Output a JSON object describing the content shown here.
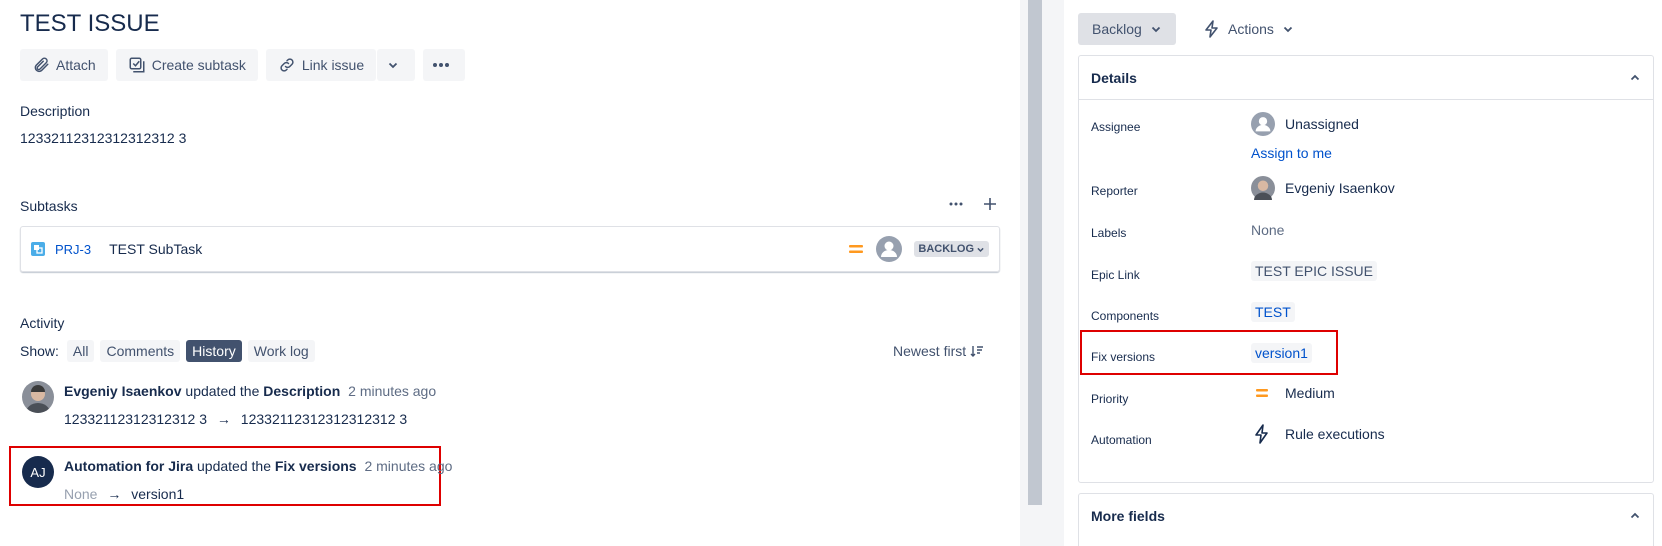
{
  "issue": {
    "title": "TEST ISSUE"
  },
  "toolbar": {
    "attach": "Attach",
    "create_subtask": "Create subtask",
    "link_issue": "Link issue"
  },
  "description": {
    "label": "Description",
    "text": "12332112312312312312 3"
  },
  "subtasks": {
    "label": "Subtasks",
    "items": [
      {
        "key": "PRJ-3",
        "summary": "TEST SubTask",
        "status": "BACKLOG"
      }
    ]
  },
  "activity": {
    "label": "Activity",
    "show_label": "Show:",
    "filters": [
      "All",
      "Comments",
      "History",
      "Work log"
    ],
    "active_filter": "History",
    "sort_label": "Newest first",
    "entries": [
      {
        "author": "Evgeniy Isaenkov",
        "verb": "updated the",
        "field": "Description",
        "time": "2 minutes ago",
        "from": "12332112312312312 3",
        "arrow": "→",
        "to": "12332112312312312312 3"
      },
      {
        "author": "Automation for Jira",
        "initials": "AJ",
        "verb": "updated the",
        "field": "Fix versions",
        "time": "2 minutes ago",
        "from": "None",
        "arrow": "→",
        "to": "version1"
      }
    ]
  },
  "sidebar": {
    "status_button": "Backlog",
    "actions_button": "Actions",
    "details": {
      "title": "Details",
      "fields": {
        "assignee_label": "Assignee",
        "assignee_value": "Unassigned",
        "assign_to_me": "Assign to me",
        "reporter_label": "Reporter",
        "reporter_value": "Evgeniy Isaenkov",
        "labels_label": "Labels",
        "labels_value": "None",
        "epic_label": "Epic Link",
        "epic_value": "TEST EPIC ISSUE",
        "components_label": "Components",
        "components_value": "TEST",
        "fix_versions_label": "Fix versions",
        "fix_versions_value": "version1",
        "priority_label": "Priority",
        "priority_value": "Medium",
        "automation_label": "Automation",
        "automation_value": "Rule executions"
      }
    },
    "more_fields": {
      "title": "More fields"
    }
  },
  "colors": {
    "link_blue": "#0052cc",
    "priority_orange": "#ff991f",
    "highlight_red": "#de0000",
    "active_filter_bg": "#42526e"
  }
}
